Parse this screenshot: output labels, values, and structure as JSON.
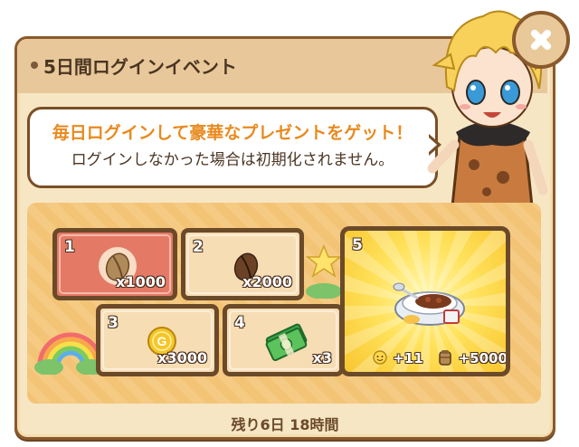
{
  "dialog": {
    "title": "5日間ログインイベント",
    "message_line1": "毎日ログインして豪華なプレゼントをゲット！",
    "message_line2": "ログインしなかった場合は初期化されません。",
    "remaining": "残り6日 18時間"
  },
  "rewards": [
    {
      "day": "1",
      "qty": "x1000",
      "item": "coffee-bean-light-icon",
      "state": "current"
    },
    {
      "day": "2",
      "qty": "x2000",
      "item": "coffee-bean-icon"
    },
    {
      "day": "3",
      "qty": "x3000",
      "item": "gold-coin-icon"
    },
    {
      "day": "4",
      "qty": "x3",
      "item": "money-bundle-icon"
    },
    {
      "day": "5",
      "item": "curry-dish-icon",
      "bonus": [
        {
          "icon": "smiley-sun-icon",
          "value": "+11"
        },
        {
          "icon": "bean-sack-icon",
          "value": "+5000"
        }
      ]
    }
  ],
  "colors": {
    "panel": "#f7e6c4",
    "border": "#8a5a2c",
    "accent_orange": "#e88a1e",
    "current_tile": "#e47a66",
    "special_tile": "#ffe25c"
  }
}
